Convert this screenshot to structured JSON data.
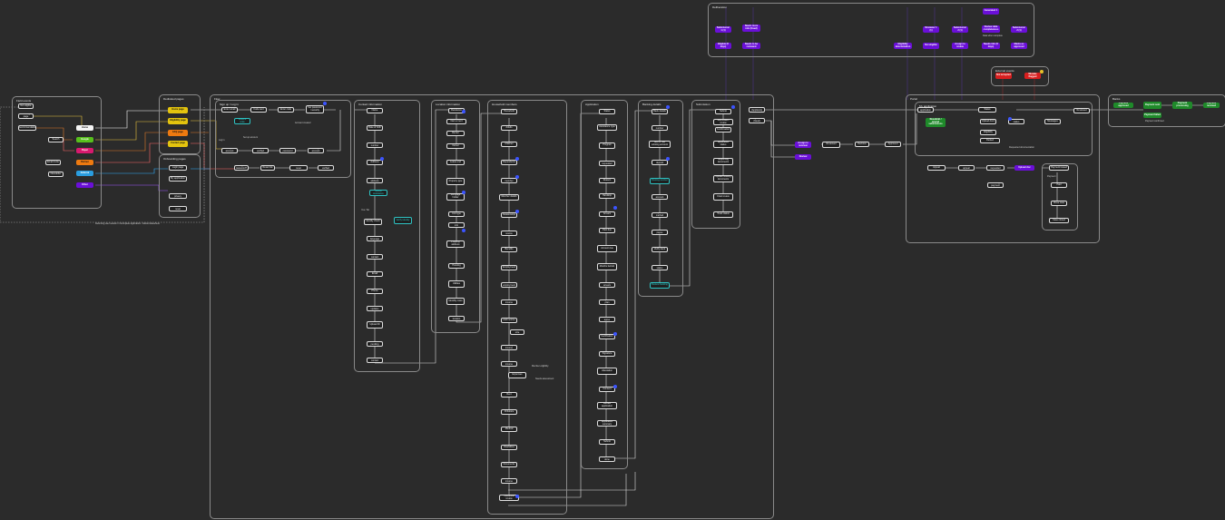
{
  "groups": {
    "deliberation_group": "Deliberation",
    "external_group": "External events",
    "inputs_group": "Field events",
    "dedicated_pages_group": "Dedicated pages",
    "onboarding_pages_group": "Onboarding pages",
    "flow_group": "Flow",
    "signup_group": "Sign up / Log in",
    "identity_group": "Identity",
    "contact_group": "Contact information",
    "location_group": "Location information",
    "household_group": "Household members",
    "application_group": "Application",
    "banking_group": "Banking details",
    "submission_group": "Submission",
    "portal_group": "Portal",
    "my_application_group": "My application",
    "bank_group": "Banks"
  },
  "deliberation": {
    "n1": "Generated 1",
    "n2": "Submission 1 (1)",
    "n3": "Needs more info (fraud)",
    "n4": "Reviewer 1 (1)",
    "n5": "Submission 2 (1)",
    "n6": "Review data completeness",
    "n7": "Needs info (5 days)",
    "n8": "Submission 2 (1)",
    "n9": "Eligible (5 days)",
    "n10": "Needs to be reviewed",
    "n11": "Eligibility determination",
    "n12": "Not eligible",
    "n13": "Assign to review",
    "n14": "Marks as approved",
    "note": "Data when complete"
  },
  "external": {
    "n1": "Not accepted",
    "n2": "Mistake flagged"
  },
  "inputs": {
    "n1": "Not eligible",
    "n2": "Landing page",
    "n3": "Recommendation",
    "n4": "Search",
    "n5": "Email invite",
    "n6": "Newsletter",
    "c1": "Home",
    "c2": "Google",
    "c3": "Paper",
    "c4": "Partner",
    "c5": "Referral",
    "c6": "Other",
    "footer": "Returning user session / incomplete application / started elsewhere"
  },
  "dedicated": {
    "n1": "Home page",
    "n2": "Eligibility page",
    "n3": "FAQ page",
    "n4": "Contact page"
  },
  "onboarding": {
    "n1": "Login page",
    "n2": "My application",
    "n3": "Terms & privacy",
    "n4": "Password reset"
  },
  "signup": {
    "n1": "Enter email",
    "n2": "Code sent",
    "n3": "Enter code",
    "n4": "Set password / security",
    "n5": "Already has account",
    "n6": "Email verified",
    "n7": "Email verified",
    "n8": "Enter password",
    "n9": "Verify account",
    "n10": "Forgot password?",
    "n11": "Reset link",
    "n12": "Password reset",
    "n13": "Resend code",
    "note1": "Log in",
    "note2": "Set up account",
    "note3": "Account created"
  },
  "identity": {
    "n1": "Name",
    "n2": "Date of birth",
    "n3": "Phone number",
    "n4": "Address",
    "n5": "Mailing address",
    "n6": "Preferred language",
    "n7": "Preferred contact",
    "n8": "Email",
    "n9": "Phone",
    "n10": "Text updates",
    "n11": "Verify identity",
    "n12": "Upload ID",
    "n13": "Verification pending",
    "n14": "Identity verified",
    "n15": "Identity check",
    "n16": "Save & continue",
    "n17": "Review contact",
    "n18": "Needs assistance",
    "note": "Yes / No"
  },
  "location": {
    "n1": "Residence",
    "n2": "Own or rent",
    "n3": "Renter",
    "n4": "Owner",
    "n5": "Lease end",
    "n6": "Property type",
    "n7": "Mortgage holder",
    "n8": "Unit type",
    "n9": "Landlord info",
    "n10": "Property address",
    "n11": "Housing",
    "n12": "Utilities",
    "n13": "Monthly costs",
    "n14": "Add unit",
    "n15": "Additional property",
    "n16": "Review location",
    "n17": "Location details"
  },
  "household": {
    "n1": "Household",
    "n2": "Adults",
    "n3": "Children",
    "n4": "Dependents",
    "n5": "Add member",
    "n6": "Member details",
    "n7": "Relationship",
    "n8": "Income source",
    "n9": "Benefits",
    "n10": "Employment",
    "n11": "Self employment",
    "n12": "Other income",
    "n13": "Add income",
    "n14": "Household size",
    "n15": "Monthly income",
    "n16": "Annual income",
    "n17": "Expenses",
    "n18": "Rent",
    "n19": "Childcare",
    "n20": "Medical",
    "n21": "Disabilities",
    "n22": "Documents",
    "n23": "Upload income",
    "n24": "Household review",
    "n25": "Upload document",
    "note1": "Member eligibility",
    "note2": "Needs assessment"
  },
  "application": {
    "n1": "Status",
    "n2": "Assistance type",
    "n3": "Program",
    "n4": "Amount requested",
    "n5": "Reason",
    "n6": "Hardship",
    "n7": "Arrears",
    "n8": "Past due",
    "n9": "Amount due",
    "n10": "Months behind",
    "n11": "Utility",
    "n12": "Utility arrears",
    "n13": "Payment plan",
    "n14": "Landlord agree",
    "n15": "Certification",
    "n16": "Signature",
    "n17": "Attestation",
    "n18": "Date",
    "n19": "Consent",
    "n20": "Review application",
    "n21": "Edit section",
    "n22": "Application summary",
    "n23": "Submit",
    "n24": "Upload proof",
    "n25": "Proof of income",
    "n26": "Proof of residence",
    "n27": "Lease upload",
    "n28": "Application done"
  },
  "banking": {
    "n1": "Bank details",
    "n2": "Account number",
    "n3": "Add or use existing account",
    "n4": "Direct deposit",
    "n5": "Routing number",
    "n6": "Confirm account",
    "n7": "Payment method",
    "n8": "Landlord payee",
    "n9": "Verify bank",
    "n10": "Check status",
    "n11": "Bank verified",
    "n12": "Review banking"
  },
  "submission": {
    "n1": "Submit",
    "n2": "Submission review",
    "n3": "Confirmation",
    "n4": "Application status",
    "n5": "Supporting documents",
    "n6": "Missing documents",
    "n7": "Upload missing documents",
    "n8": "Final review",
    "n9": "Track status",
    "n10": "Submitted",
    "n11": "Received",
    "n12": "Eligible (Add'l)",
    "n13": "Decision",
    "n14": "Notify",
    "n15": "Needs info",
    "n16": "Document request",
    "n17": "Awaiting applicant",
    "note1": "Under review"
  },
  "portal": {
    "n1": "My application",
    "n2": "Resubmit / amend submissions",
    "n3": "Status",
    "n4": "Upload docs",
    "n5": "Review status",
    "n6": "Messages",
    "n7": "Eligibility",
    "n8": "Denied",
    "n9": "Appeal",
    "n10": "Submit appeal",
    "n11": "Documents requested",
    "n12": "Upload doc",
    "n13": "Awaiting payment",
    "n14": "Payment issued",
    "n15": "Paid",
    "n16": "Close case",
    "n17": "Contact us",
    "n18": "Update info",
    "n19": "Send message",
    "n20": "Case closed",
    "n21": "Resubmit",
    "n22": "Reviewed",
    "note1": "Requested documentation",
    "note2": "Payment"
  },
  "flow_mid": {
    "n1": "Submitted (Applicant)",
    "n2": "Rejected (fraud)",
    "n3": "Assign to reviewer",
    "n4": "Review",
    "n5": "Reviewed",
    "n6": "Decision",
    "n7": "Approved",
    "n8": "Denied"
  },
  "banks": {
    "n1": "Payment approved",
    "n2": "Payment sent",
    "n3": "Payment processing",
    "n4": "Payment received",
    "n5": "Archived",
    "n6": "Payment failed",
    "note": "Payment confirmed"
  },
  "colors": {
    "background": "#2b2b2b",
    "purple": "#6a0fd8",
    "red": "#d81f1f",
    "green": "#1f8a2a",
    "yellow": "#e4c40e",
    "orange": "#ee7a10",
    "blue_marker": "#3b54ff"
  }
}
